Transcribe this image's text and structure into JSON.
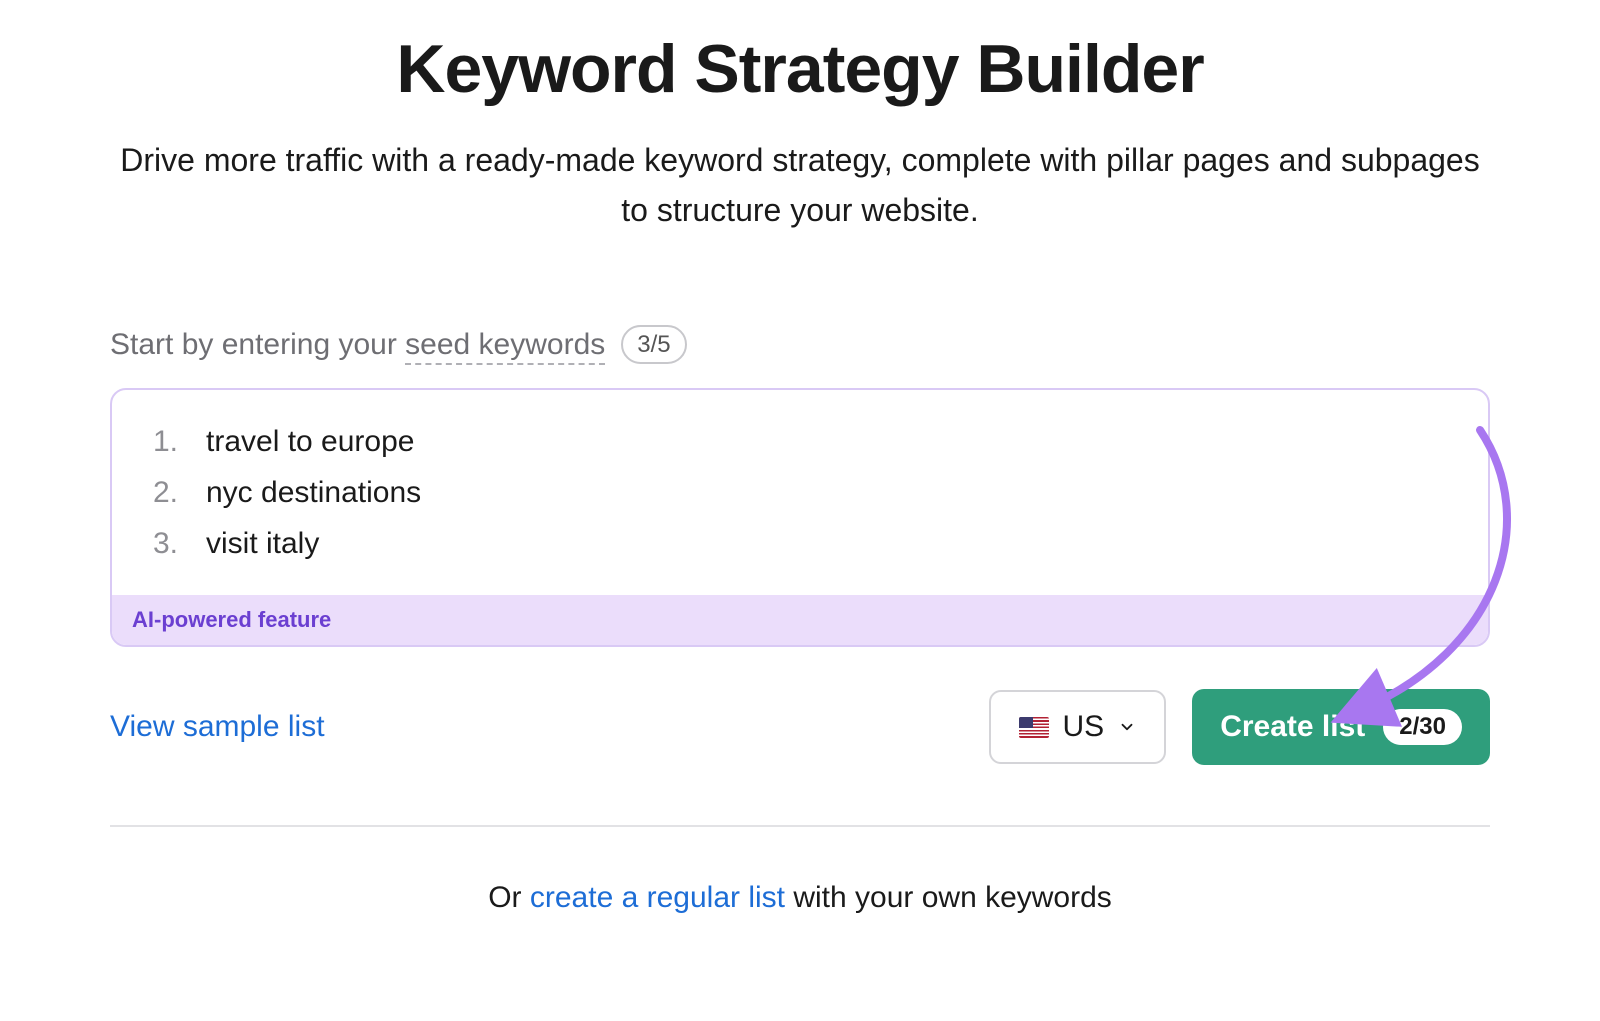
{
  "header": {
    "title": "Keyword Strategy Builder",
    "subtitle": "Drive more traffic with a ready-made keyword strategy, complete with pillar pages and subpages to structure your website."
  },
  "seed": {
    "label_prefix": "Start by entering your ",
    "label_dashed": "seed keywords",
    "count": "3/5",
    "keywords": [
      "travel to europe",
      "nyc destinations",
      "visit italy"
    ],
    "ai_badge": "AI-powered feature"
  },
  "actions": {
    "view_sample": "View sample list",
    "country_code": "US",
    "create_label": "Create list",
    "create_count": "2/30"
  },
  "alt": {
    "prefix": "Or ",
    "link": "create a regular list",
    "suffix": " with your own keywords"
  }
}
